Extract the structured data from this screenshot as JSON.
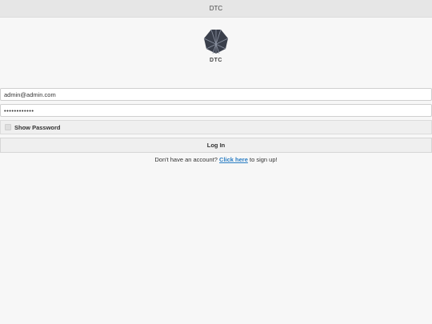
{
  "window": {
    "title": "DTC"
  },
  "logo": {
    "icon": "hexagon-logo-icon",
    "text": "DTC",
    "color": "#3a3f4b"
  },
  "form": {
    "email_value": "admin@admin.com",
    "password_value": "••••••••••••",
    "show_password_label": "Show Password",
    "show_password_checked": false,
    "login_label": "Log In"
  },
  "signup": {
    "prefix": "Don't have an account?",
    "link_text": "Click here",
    "suffix": "to sign up!",
    "link_color": "#2a7dc3"
  }
}
